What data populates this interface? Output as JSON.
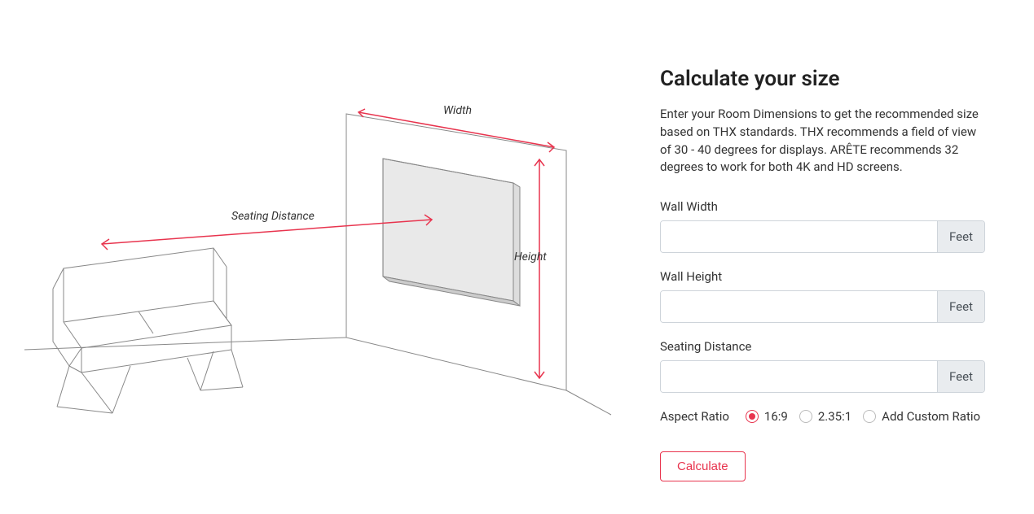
{
  "heading": "Calculate your size",
  "description": "Enter your Room Dimensions to get the recommended size based on THX standards. THX recommends a field of view of 30 - 40 degrees for displays. ARÊTE recommends 32 degrees to work for both 4K and HD screens.",
  "diagram_labels": {
    "width": "Width",
    "height": "Height",
    "seating": "Seating Distance"
  },
  "fields": {
    "wall_width": {
      "label": "Wall Width",
      "unit": "Feet",
      "value": ""
    },
    "wall_height": {
      "label": "Wall Height",
      "unit": "Feet",
      "value": ""
    },
    "seating_distance": {
      "label": "Seating Distance",
      "unit": "Feet",
      "value": ""
    }
  },
  "aspect_ratio": {
    "label": "Aspect Ratio",
    "options": [
      {
        "label": "16:9",
        "checked": true
      },
      {
        "label": "2.35:1",
        "checked": false
      },
      {
        "label": "Add Custom Ratio",
        "checked": false
      }
    ]
  },
  "button": {
    "calculate": "Calculate"
  },
  "colors": {
    "accent": "#e8344e"
  }
}
